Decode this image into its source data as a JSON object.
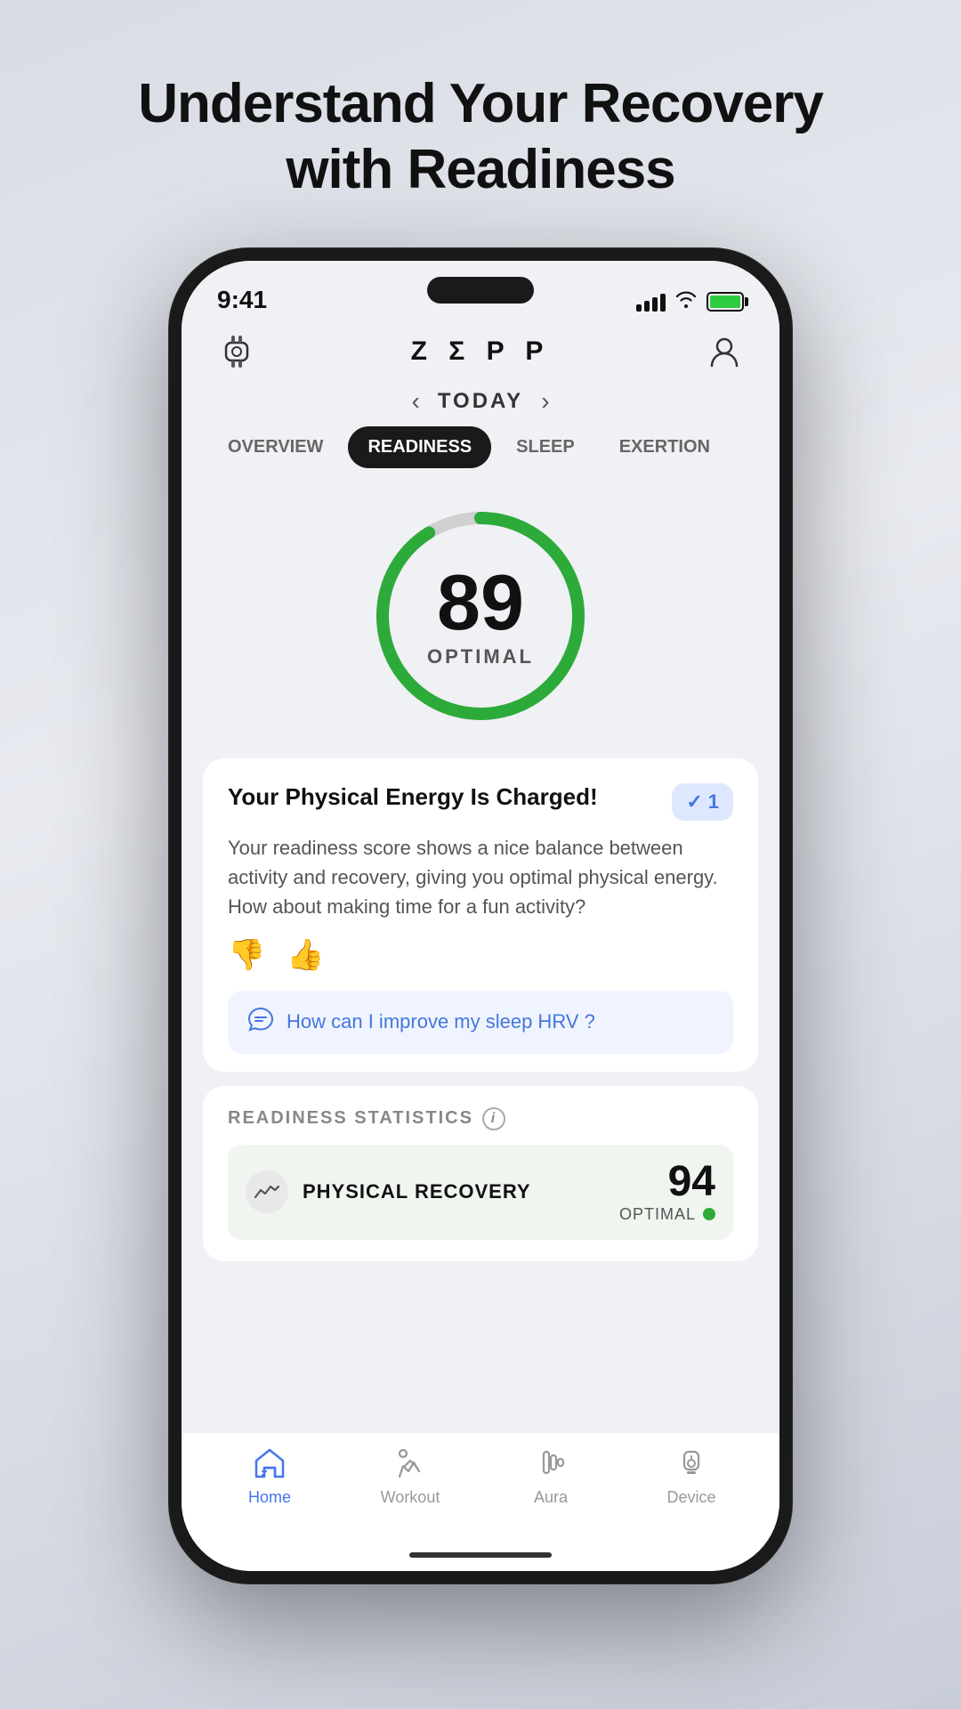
{
  "page": {
    "title_line1": "Understand Your Recovery",
    "title_line2": "with Readiness"
  },
  "status_bar": {
    "time": "9:41",
    "battery_label": "100"
  },
  "header": {
    "logo": "Z Σ P P"
  },
  "date_nav": {
    "label": "TODAY",
    "prev_arrow": "‹",
    "next_arrow": "›"
  },
  "tabs": [
    {
      "id": "overview",
      "label": "OVERVIEW",
      "active": false
    },
    {
      "id": "readiness",
      "label": "READINESS",
      "active": true
    },
    {
      "id": "sleep",
      "label": "SLEEP",
      "active": false
    },
    {
      "id": "exertion",
      "label": "EXERTION",
      "active": false
    }
  ],
  "score": {
    "value": "89",
    "label": "OPTIMAL",
    "ring_progress": 88
  },
  "insight_card": {
    "title": "Your Physical Energy Is Charged!",
    "badge_count": "1",
    "body": "Your readiness score shows a nice balance between activity and recovery, giving you optimal physical energy. How about making time for a fun activity?",
    "ai_question": "How can I improve my sleep HRV ?"
  },
  "stats": {
    "section_label": "READINESS STATISTICS",
    "rows": [
      {
        "id": "physical-recovery",
        "name": "PHYSICAL RECOVERY",
        "value": "94",
        "status": "OPTIMAL",
        "indicator_color": "#2dab3a"
      }
    ]
  },
  "bottom_nav": {
    "items": [
      {
        "id": "home",
        "label": "Home",
        "active": true
      },
      {
        "id": "workout",
        "label": "Workout",
        "active": false
      },
      {
        "id": "aura",
        "label": "Aura",
        "active": false
      },
      {
        "id": "device",
        "label": "Device",
        "active": false
      }
    ]
  }
}
